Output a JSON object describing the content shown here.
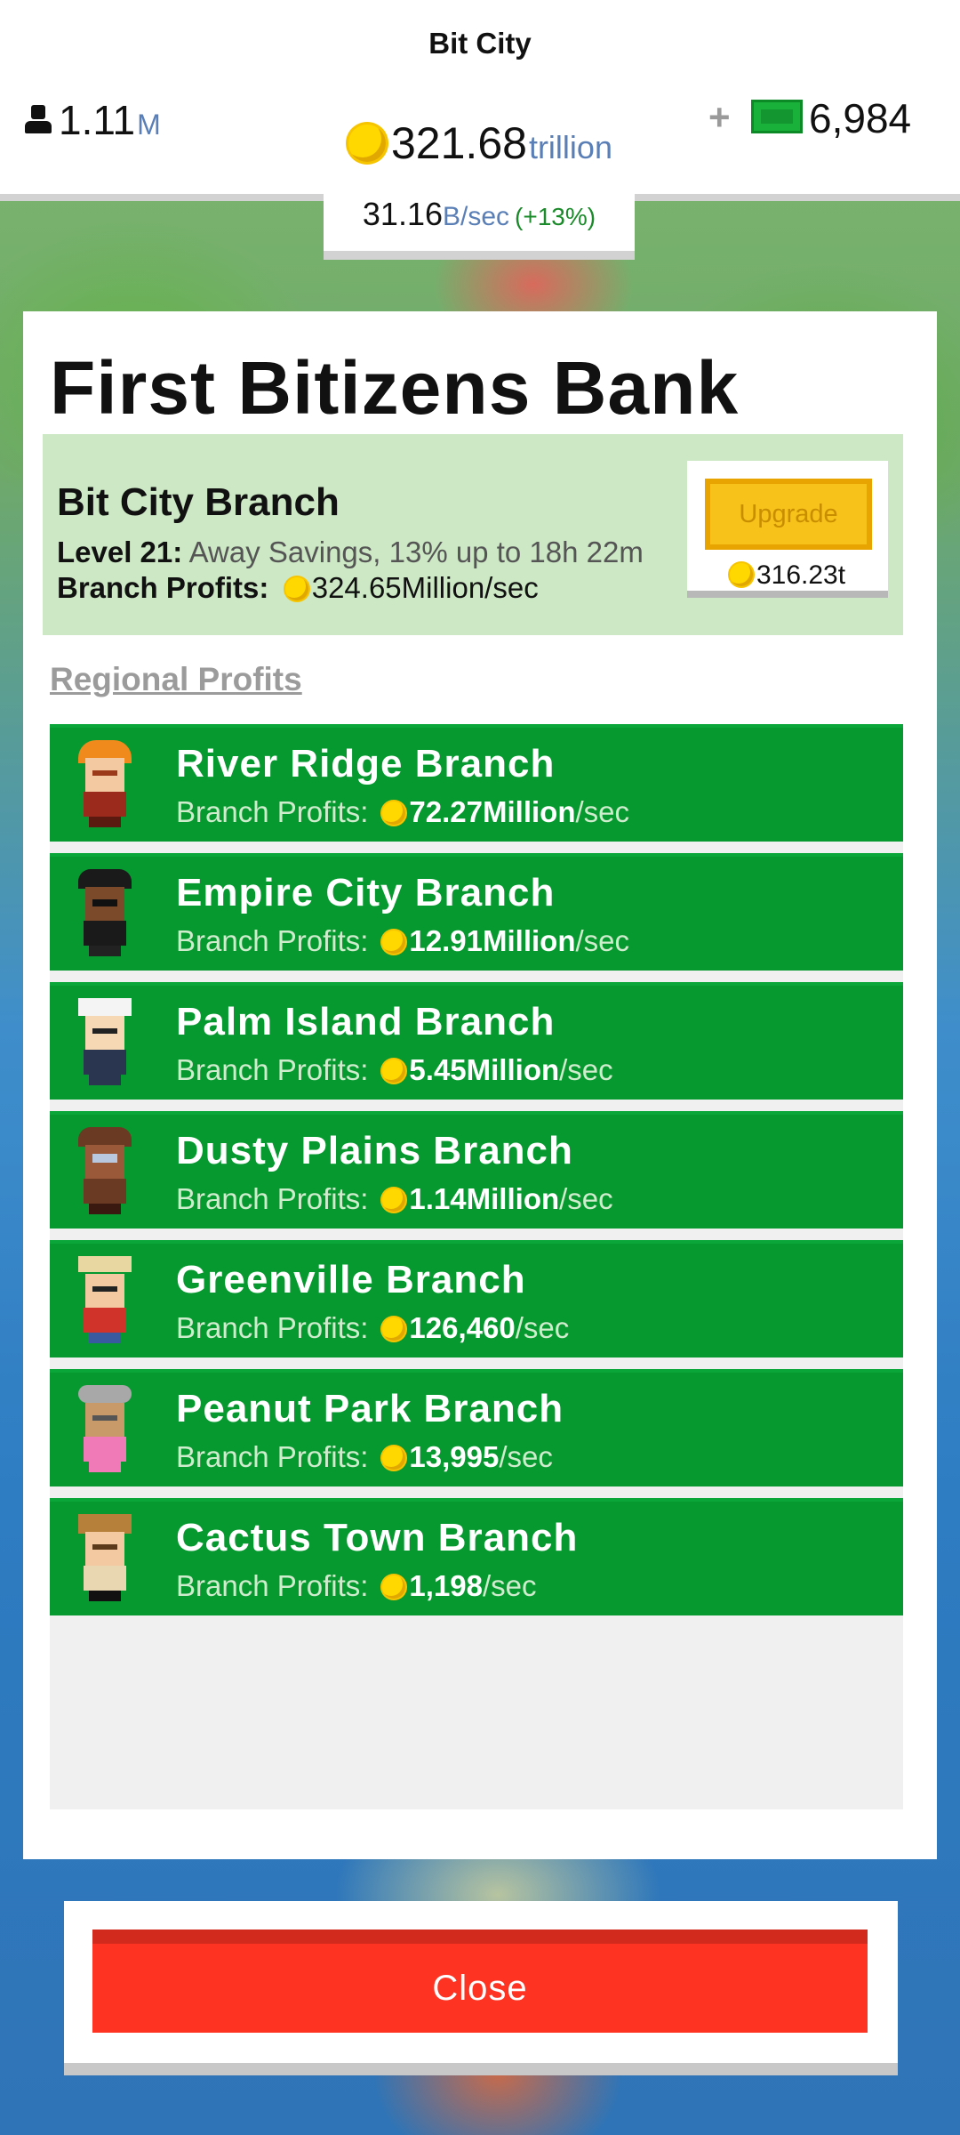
{
  "header": {
    "city_title": "Bit City",
    "population": {
      "value": "1.11",
      "unit": "M"
    },
    "coins": {
      "value": "321.68",
      "unit": "trillion"
    },
    "cash": {
      "plus": "+",
      "value": "6,984"
    },
    "rate": {
      "value": "31.16",
      "unit": "B/sec",
      "percent": "(+13%)"
    }
  },
  "bank": {
    "title": "First Bitizens Bank",
    "hq": {
      "name": "Bit City Branch",
      "level_label": "Level 21:",
      "level_desc": "Away Savings, 13% up to 18h 22m",
      "profit_label": "Branch Profits:",
      "profit_value": "324.65Million/sec",
      "upgrade_label": "Upgrade",
      "upgrade_cost": "316.23t"
    },
    "regional_label": "Regional Profits",
    "branches": [
      {
        "name": "River Ridge Branch",
        "profit_label": "Branch Profits:",
        "value": "72.27Million",
        "per": "/sec"
      },
      {
        "name": "Empire City Branch",
        "profit_label": "Branch Profits:",
        "value": "12.91Million",
        "per": "/sec"
      },
      {
        "name": "Palm Island Branch",
        "profit_label": "Branch Profits:",
        "value": "5.45Million",
        "per": "/sec"
      },
      {
        "name": "Dusty Plains Branch",
        "profit_label": "Branch Profits:",
        "value": "1.14Million",
        "per": "/sec"
      },
      {
        "name": "Greenville Branch",
        "profit_label": "Branch Profits:",
        "value": "126,460",
        "per": "/sec"
      },
      {
        "name": "Peanut Park Branch",
        "profit_label": "Branch Profits:",
        "value": "13,995",
        "per": "/sec"
      },
      {
        "name": "Cactus Town Branch",
        "profit_label": "Branch Profits:",
        "value": "1,198",
        "per": "/sec"
      }
    ]
  },
  "footer": {
    "close_label": "Close"
  },
  "icons": {
    "population": "person-icon",
    "coin": "coin-icon",
    "cash": "cash-icon"
  }
}
